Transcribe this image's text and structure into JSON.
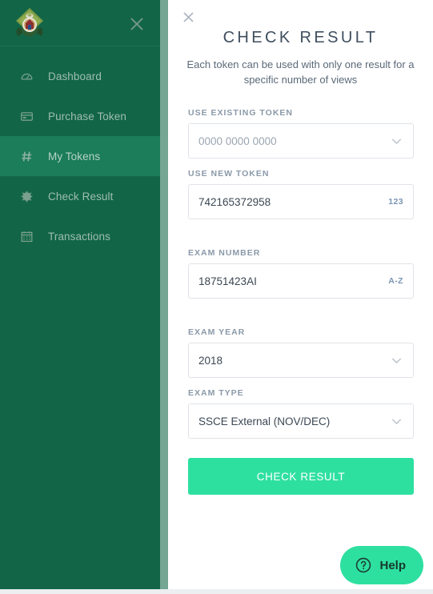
{
  "sidebar": {
    "logo_alt": "coat-of-arms-logo",
    "close_label": "×",
    "items": [
      {
        "label": "Dashboard",
        "icon": "gauge-icon",
        "active": false
      },
      {
        "label": "Purchase Token",
        "icon": "credit-card-icon",
        "active": false
      },
      {
        "label": "My Tokens",
        "icon": "hash-icon",
        "active": true
      },
      {
        "label": "Check Result",
        "icon": "badge-icon",
        "active": false
      },
      {
        "label": "Transactions",
        "icon": "calendar-icon",
        "active": false
      }
    ],
    "colors": {
      "background": "#126647",
      "active_background": "#1b7d5a",
      "label": "#9fbdae"
    }
  },
  "content": {
    "close_label": "×",
    "title": "CHECK RESULT",
    "subtitle": "Each token can be used with only one result for a specific number of views",
    "fields": {
      "existing_token": {
        "label": "USE EXISTING TOKEN",
        "value": "0000 0000 0000",
        "is_placeholder": true,
        "control": "select",
        "icon": "chevron-down-icon"
      },
      "new_token": {
        "label": "USE NEW TOKEN",
        "value": "742165372958",
        "is_placeholder": false,
        "control": "text",
        "adornment": "123"
      },
      "exam_number": {
        "label": "EXAM NUMBER",
        "value": "18751423AI",
        "is_placeholder": false,
        "control": "text",
        "adornment": "A-Z"
      },
      "exam_year": {
        "label": "EXAM YEAR",
        "value": "2018",
        "is_placeholder": false,
        "control": "select",
        "icon": "chevron-down-icon"
      },
      "exam_type": {
        "label": "EXAM TYPE",
        "value": "SSCE External (NOV/DEC)",
        "is_placeholder": false,
        "control": "select",
        "icon": "chevron-down-icon"
      }
    },
    "submit_label": "CHECK RESULT",
    "colors": {
      "accent": "#2ee0a0",
      "title": "#3f4e5e",
      "adornment": "#7b95b4"
    }
  },
  "help_widget": {
    "label": "Help",
    "icon": "question-mark-circle-icon",
    "color": "#2ee0a0"
  }
}
